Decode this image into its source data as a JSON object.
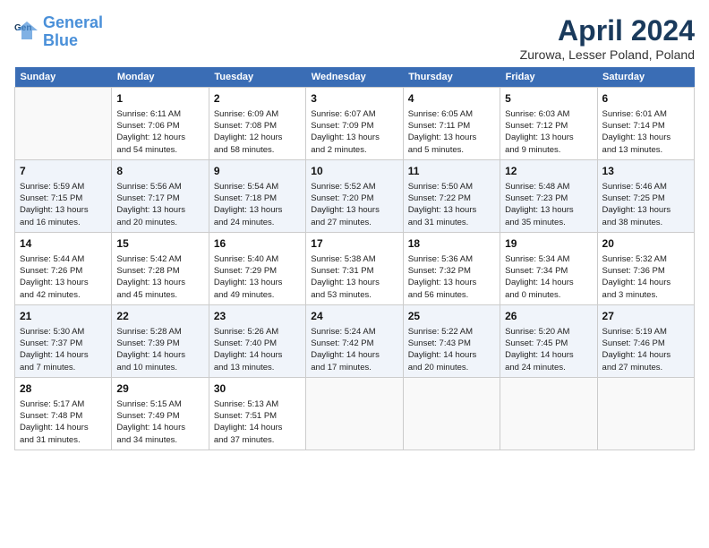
{
  "header": {
    "logo_line1": "General",
    "logo_line2": "Blue",
    "month": "April 2024",
    "location": "Zurowa, Lesser Poland, Poland"
  },
  "days_of_week": [
    "Sunday",
    "Monday",
    "Tuesday",
    "Wednesday",
    "Thursday",
    "Friday",
    "Saturday"
  ],
  "weeks": [
    [
      {
        "day": "",
        "info": ""
      },
      {
        "day": "1",
        "info": "Sunrise: 6:11 AM\nSunset: 7:06 PM\nDaylight: 12 hours\nand 54 minutes."
      },
      {
        "day": "2",
        "info": "Sunrise: 6:09 AM\nSunset: 7:08 PM\nDaylight: 12 hours\nand 58 minutes."
      },
      {
        "day": "3",
        "info": "Sunrise: 6:07 AM\nSunset: 7:09 PM\nDaylight: 13 hours\nand 2 minutes."
      },
      {
        "day": "4",
        "info": "Sunrise: 6:05 AM\nSunset: 7:11 PM\nDaylight: 13 hours\nand 5 minutes."
      },
      {
        "day": "5",
        "info": "Sunrise: 6:03 AM\nSunset: 7:12 PM\nDaylight: 13 hours\nand 9 minutes."
      },
      {
        "day": "6",
        "info": "Sunrise: 6:01 AM\nSunset: 7:14 PM\nDaylight: 13 hours\nand 13 minutes."
      }
    ],
    [
      {
        "day": "7",
        "info": "Sunrise: 5:59 AM\nSunset: 7:15 PM\nDaylight: 13 hours\nand 16 minutes."
      },
      {
        "day": "8",
        "info": "Sunrise: 5:56 AM\nSunset: 7:17 PM\nDaylight: 13 hours\nand 20 minutes."
      },
      {
        "day": "9",
        "info": "Sunrise: 5:54 AM\nSunset: 7:18 PM\nDaylight: 13 hours\nand 24 minutes."
      },
      {
        "day": "10",
        "info": "Sunrise: 5:52 AM\nSunset: 7:20 PM\nDaylight: 13 hours\nand 27 minutes."
      },
      {
        "day": "11",
        "info": "Sunrise: 5:50 AM\nSunset: 7:22 PM\nDaylight: 13 hours\nand 31 minutes."
      },
      {
        "day": "12",
        "info": "Sunrise: 5:48 AM\nSunset: 7:23 PM\nDaylight: 13 hours\nand 35 minutes."
      },
      {
        "day": "13",
        "info": "Sunrise: 5:46 AM\nSunset: 7:25 PM\nDaylight: 13 hours\nand 38 minutes."
      }
    ],
    [
      {
        "day": "14",
        "info": "Sunrise: 5:44 AM\nSunset: 7:26 PM\nDaylight: 13 hours\nand 42 minutes."
      },
      {
        "day": "15",
        "info": "Sunrise: 5:42 AM\nSunset: 7:28 PM\nDaylight: 13 hours\nand 45 minutes."
      },
      {
        "day": "16",
        "info": "Sunrise: 5:40 AM\nSunset: 7:29 PM\nDaylight: 13 hours\nand 49 minutes."
      },
      {
        "day": "17",
        "info": "Sunrise: 5:38 AM\nSunset: 7:31 PM\nDaylight: 13 hours\nand 53 minutes."
      },
      {
        "day": "18",
        "info": "Sunrise: 5:36 AM\nSunset: 7:32 PM\nDaylight: 13 hours\nand 56 minutes."
      },
      {
        "day": "19",
        "info": "Sunrise: 5:34 AM\nSunset: 7:34 PM\nDaylight: 14 hours\nand 0 minutes."
      },
      {
        "day": "20",
        "info": "Sunrise: 5:32 AM\nSunset: 7:36 PM\nDaylight: 14 hours\nand 3 minutes."
      }
    ],
    [
      {
        "day": "21",
        "info": "Sunrise: 5:30 AM\nSunset: 7:37 PM\nDaylight: 14 hours\nand 7 minutes."
      },
      {
        "day": "22",
        "info": "Sunrise: 5:28 AM\nSunset: 7:39 PM\nDaylight: 14 hours\nand 10 minutes."
      },
      {
        "day": "23",
        "info": "Sunrise: 5:26 AM\nSunset: 7:40 PM\nDaylight: 14 hours\nand 13 minutes."
      },
      {
        "day": "24",
        "info": "Sunrise: 5:24 AM\nSunset: 7:42 PM\nDaylight: 14 hours\nand 17 minutes."
      },
      {
        "day": "25",
        "info": "Sunrise: 5:22 AM\nSunset: 7:43 PM\nDaylight: 14 hours\nand 20 minutes."
      },
      {
        "day": "26",
        "info": "Sunrise: 5:20 AM\nSunset: 7:45 PM\nDaylight: 14 hours\nand 24 minutes."
      },
      {
        "day": "27",
        "info": "Sunrise: 5:19 AM\nSunset: 7:46 PM\nDaylight: 14 hours\nand 27 minutes."
      }
    ],
    [
      {
        "day": "28",
        "info": "Sunrise: 5:17 AM\nSunset: 7:48 PM\nDaylight: 14 hours\nand 31 minutes."
      },
      {
        "day": "29",
        "info": "Sunrise: 5:15 AM\nSunset: 7:49 PM\nDaylight: 14 hours\nand 34 minutes."
      },
      {
        "day": "30",
        "info": "Sunrise: 5:13 AM\nSunset: 7:51 PM\nDaylight: 14 hours\nand 37 minutes."
      },
      {
        "day": "",
        "info": ""
      },
      {
        "day": "",
        "info": ""
      },
      {
        "day": "",
        "info": ""
      },
      {
        "day": "",
        "info": ""
      }
    ]
  ]
}
